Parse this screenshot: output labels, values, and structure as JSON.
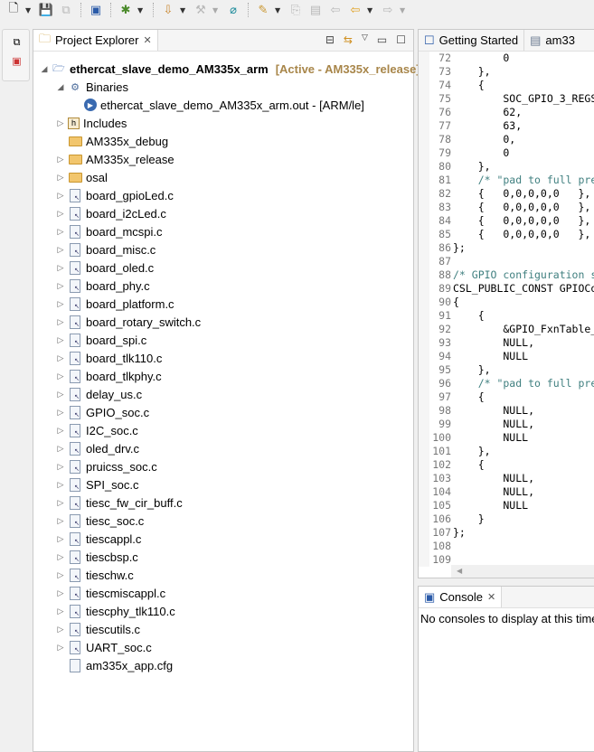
{
  "toolbar": {
    "icons": [
      "new-icon",
      "save-icon",
      "save-all-icon",
      "terminal-icon",
      "debug-icon",
      "build-config-icon",
      "build-icon",
      "search-icon",
      "run-icon",
      "history-icon",
      "doc-icon",
      "pin-icon",
      "back-icon",
      "forward-icon"
    ]
  },
  "project_explorer": {
    "title": "Project Explorer",
    "items": [
      {
        "label": "ethercat_slave_demo_AM335x_arm",
        "suffix": "[Active - AM335x_release]",
        "type": "project",
        "level": 0,
        "state": "expanded"
      },
      {
        "label": "Binaries",
        "type": "binaries",
        "level": 1,
        "state": "expanded"
      },
      {
        "label": "ethercat_slave_demo_AM335x_arm.out - [ARM/le]",
        "type": "binary",
        "level": 2,
        "state": "none"
      },
      {
        "label": "Includes",
        "type": "includes",
        "level": 1,
        "state": "collapsed"
      },
      {
        "label": "AM335x_debug",
        "type": "folder",
        "level": 1,
        "state": "none"
      },
      {
        "label": "AM335x_release",
        "type": "folder",
        "level": 1,
        "state": "collapsed"
      },
      {
        "label": "osal",
        "type": "folder",
        "level": 1,
        "state": "collapsed"
      },
      {
        "label": "board_gpioLed.c",
        "type": "c",
        "level": 1,
        "state": "collapsed"
      },
      {
        "label": "board_i2cLed.c",
        "type": "c",
        "level": 1,
        "state": "collapsed"
      },
      {
        "label": "board_mcspi.c",
        "type": "c",
        "level": 1,
        "state": "collapsed"
      },
      {
        "label": "board_misc.c",
        "type": "c",
        "level": 1,
        "state": "collapsed"
      },
      {
        "label": "board_oled.c",
        "type": "c",
        "level": 1,
        "state": "collapsed"
      },
      {
        "label": "board_phy.c",
        "type": "c",
        "level": 1,
        "state": "collapsed"
      },
      {
        "label": "board_platform.c",
        "type": "c",
        "level": 1,
        "state": "collapsed"
      },
      {
        "label": "board_rotary_switch.c",
        "type": "c",
        "level": 1,
        "state": "collapsed"
      },
      {
        "label": "board_spi.c",
        "type": "c",
        "level": 1,
        "state": "collapsed"
      },
      {
        "label": "board_tlk110.c",
        "type": "c",
        "level": 1,
        "state": "collapsed"
      },
      {
        "label": "board_tlkphy.c",
        "type": "c",
        "level": 1,
        "state": "collapsed"
      },
      {
        "label": "delay_us.c",
        "type": "c",
        "level": 1,
        "state": "collapsed"
      },
      {
        "label": "GPIO_soc.c",
        "type": "c",
        "level": 1,
        "state": "collapsed"
      },
      {
        "label": "I2C_soc.c",
        "type": "c",
        "level": 1,
        "state": "collapsed"
      },
      {
        "label": "oled_drv.c",
        "type": "c",
        "level": 1,
        "state": "collapsed"
      },
      {
        "label": "pruicss_soc.c",
        "type": "c",
        "level": 1,
        "state": "collapsed"
      },
      {
        "label": "SPI_soc.c",
        "type": "c",
        "level": 1,
        "state": "collapsed"
      },
      {
        "label": "tiesc_fw_cir_buff.c",
        "type": "c",
        "level": 1,
        "state": "collapsed"
      },
      {
        "label": "tiesc_soc.c",
        "type": "c",
        "level": 1,
        "state": "collapsed"
      },
      {
        "label": "tiescappl.c",
        "type": "c",
        "level": 1,
        "state": "collapsed"
      },
      {
        "label": "tiescbsp.c",
        "type": "c",
        "level": 1,
        "state": "collapsed"
      },
      {
        "label": "tieschw.c",
        "type": "c",
        "level": 1,
        "state": "collapsed"
      },
      {
        "label": "tiescmiscappl.c",
        "type": "c",
        "level": 1,
        "state": "collapsed"
      },
      {
        "label": "tiescphy_tlk110.c",
        "type": "c",
        "level": 1,
        "state": "collapsed"
      },
      {
        "label": "tiescutils.c",
        "type": "c",
        "level": 1,
        "state": "collapsed"
      },
      {
        "label": "UART_soc.c",
        "type": "c",
        "level": 1,
        "state": "collapsed"
      },
      {
        "label": "am335x_app.cfg",
        "type": "cfg",
        "level": 1,
        "state": "none"
      }
    ]
  },
  "editor": {
    "tabs": [
      {
        "label": "Getting Started"
      },
      {
        "label": "am33"
      }
    ],
    "lines": [
      {
        "n": "72",
        "t": "        0"
      },
      {
        "n": "73",
        "t": "    },"
      },
      {
        "n": "74",
        "t": "    {"
      },
      {
        "n": "75",
        "t": "        SOC_GPIO_3_REGS_"
      },
      {
        "n": "76",
        "t": "        62,"
      },
      {
        "n": "77",
        "t": "        63,"
      },
      {
        "n": "78",
        "t": "        0,"
      },
      {
        "n": "79",
        "t": "        0"
      },
      {
        "n": "80",
        "t": "    },"
      },
      {
        "n": "81",
        "t": "    /* \"pad to full pre",
        "c": true
      },
      {
        "n": "82",
        "t": "    {   0,0,0,0,0   },"
      },
      {
        "n": "83",
        "t": "    {   0,0,0,0,0   },"
      },
      {
        "n": "84",
        "t": "    {   0,0,0,0,0   },"
      },
      {
        "n": "85",
        "t": "    {   0,0,0,0,0   },"
      },
      {
        "n": "86",
        "t": "};"
      },
      {
        "n": "87",
        "t": ""
      },
      {
        "n": "88",
        "t": "/* GPIO configuration s",
        "c": true
      },
      {
        "n": "89",
        "t": "CSL_PUBLIC_CONST GPIOCo"
      },
      {
        "n": "90",
        "t": "{"
      },
      {
        "n": "91",
        "t": "    {"
      },
      {
        "n": "92",
        "t": "        &GPIO_FxnTable_"
      },
      {
        "n": "93",
        "t": "        NULL,"
      },
      {
        "n": "94",
        "t": "        NULL"
      },
      {
        "n": "95",
        "t": "    },"
      },
      {
        "n": "96",
        "t": "    /* \"pad to full pre",
        "c": true
      },
      {
        "n": "97",
        "t": "    {"
      },
      {
        "n": "98",
        "t": "        NULL,"
      },
      {
        "n": "99",
        "t": "        NULL,"
      },
      {
        "n": "100",
        "t": "        NULL"
      },
      {
        "n": "101",
        "t": "    },"
      },
      {
        "n": "102",
        "t": "    {"
      },
      {
        "n": "103",
        "t": "        NULL,"
      },
      {
        "n": "104",
        "t": "        NULL,"
      },
      {
        "n": "105",
        "t": "        NULL"
      },
      {
        "n": "106",
        "t": "    }"
      },
      {
        "n": "107",
        "t": "};"
      },
      {
        "n": "108",
        "t": ""
      },
      {
        "n": "109",
        "t": ""
      }
    ]
  },
  "console": {
    "title": "Console",
    "message": "No consoles to display at this time."
  }
}
